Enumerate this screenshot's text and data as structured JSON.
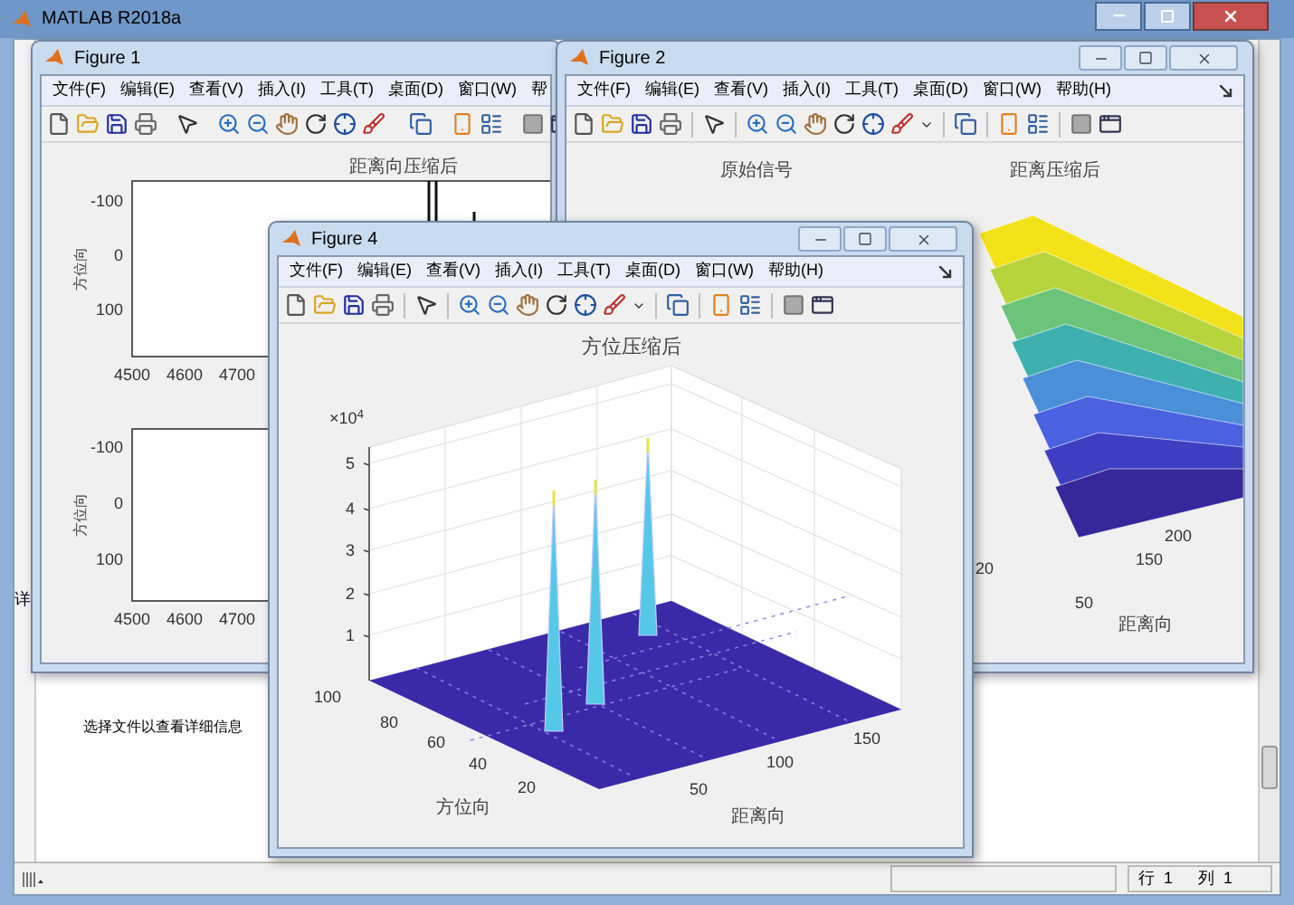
{
  "main_window": {
    "title": "MATLAB R2018a"
  },
  "left_panel": {
    "label": "详"
  },
  "details_hint": "选择文件以查看详细信息",
  "figure_1": {
    "title": "Figure 1",
    "menus": [
      "文件(F)",
      "编辑(E)",
      "查看(V)",
      "插入(I)",
      "工具(T)",
      "桌面(D)",
      "窗口(W)",
      "帮"
    ],
    "plot_title": "距离向压缩后",
    "axes": [
      {
        "yticks": [
          "-100",
          "0",
          "100"
        ],
        "xticks": [
          "4500",
          "4600",
          "4700"
        ],
        "ylabel": "方位向"
      },
      {
        "yticks": [
          "-100",
          "0",
          "100"
        ],
        "xticks": [
          "4500",
          "4600",
          "4700"
        ],
        "ylabel": "方位向"
      }
    ]
  },
  "figure_2": {
    "title": "Figure 2",
    "menus": [
      "文件(F)",
      "编辑(E)",
      "查看(V)",
      "插入(I)",
      "工具(T)",
      "桌面(D)",
      "窗口(W)",
      "帮助(H)"
    ],
    "plot_titles": [
      "原始信号",
      "距离压缩后"
    ],
    "ticks": [
      "200",
      "150",
      "50",
      "20"
    ],
    "xlabel": "距离向"
  },
  "figure_4": {
    "title": "Figure 4",
    "menus": [
      "文件(F)",
      "编辑(E)",
      "查看(V)",
      "插入(I)",
      "工具(T)",
      "桌面(D)",
      "窗口(W)",
      "帮助(H)"
    ],
    "plot_title": "方位压缩后",
    "z_exponent": "×10$^{4}$",
    "zticks": [
      "5",
      "4",
      "3",
      "2",
      "1"
    ],
    "yticks": [
      "100",
      "80",
      "60",
      "40",
      "20"
    ],
    "ylabel": "方位向",
    "xticks": [
      "50",
      "100",
      "150"
    ],
    "xlabel": "距离向"
  },
  "status_bar": {
    "row": "行  1",
    "col": "列  1"
  }
}
